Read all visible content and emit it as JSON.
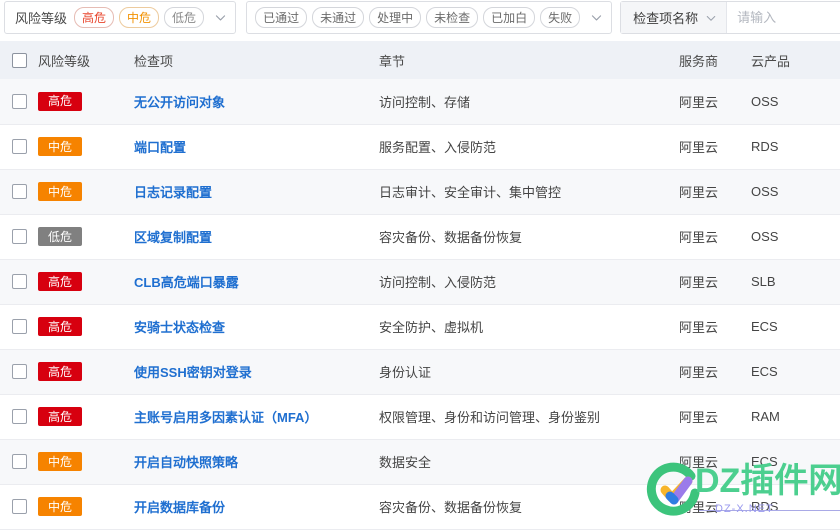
{
  "filters": {
    "risk": {
      "label": "风险等级",
      "chips": [
        {
          "text": "高危",
          "level": "high"
        },
        {
          "text": "中危",
          "level": "mid"
        },
        {
          "text": "低危",
          "level": "low"
        }
      ]
    },
    "status": {
      "chips": [
        {
          "text": "已通过"
        },
        {
          "text": "未通过"
        },
        {
          "text": "处理中"
        },
        {
          "text": "未检查"
        },
        {
          "text": "已加白"
        },
        {
          "text": "失败"
        }
      ]
    },
    "search": {
      "select_label": "检查项名称",
      "placeholder": "请输入",
      "value": ""
    }
  },
  "table": {
    "headers": {
      "risk": "风险等级",
      "item": "检查项",
      "section": "章节",
      "provider": "服务商",
      "product": "云产品"
    },
    "rows": [
      {
        "risk": "高危",
        "level": "high",
        "item": "无公开访问对象",
        "section": "访问控制、存储",
        "provider": "阿里云",
        "product": "OSS"
      },
      {
        "risk": "中危",
        "level": "mid",
        "item": "端口配置",
        "section": "服务配置、入侵防范",
        "provider": "阿里云",
        "product": "RDS"
      },
      {
        "risk": "中危",
        "level": "mid",
        "item": "日志记录配置",
        "section": "日志审计、安全审计、集中管控",
        "provider": "阿里云",
        "product": "OSS"
      },
      {
        "risk": "低危",
        "level": "low",
        "item": "区域复制配置",
        "section": "容灾备份、数据备份恢复",
        "provider": "阿里云",
        "product": "OSS"
      },
      {
        "risk": "高危",
        "level": "high",
        "item": "CLB高危端口暴露",
        "section": "访问控制、入侵防范",
        "provider": "阿里云",
        "product": "SLB"
      },
      {
        "risk": "高危",
        "level": "high",
        "item": "安骑士状态检查",
        "section": "安全防护、虚拟机",
        "provider": "阿里云",
        "product": "ECS"
      },
      {
        "risk": "高危",
        "level": "high",
        "item": "使用SSH密钥对登录",
        "section": "身份认证",
        "provider": "阿里云",
        "product": "ECS"
      },
      {
        "risk": "高危",
        "level": "high",
        "item": "主账号启用多因素认证（MFA）",
        "section": "权限管理、身份和访问管理、身份鉴别",
        "provider": "阿里云",
        "product": "RAM"
      },
      {
        "risk": "中危",
        "level": "mid",
        "item": "开启自动快照策略",
        "section": "数据安全",
        "provider": "阿里云",
        "product": "ECS"
      },
      {
        "risk": "中危",
        "level": "mid",
        "item": "开启数据库备份",
        "section": "容灾备份、数据备份恢复",
        "provider": "阿里云",
        "product": "RDS"
      }
    ]
  },
  "watermark": {
    "text": "DZ插件网",
    "sub": "DZ-X.NET"
  },
  "colors": {
    "high": "#d7000f",
    "mid": "#f68300",
    "low": "#808080",
    "link": "#1f6fd0",
    "header_bg": "#eef1f6",
    "watermark": "#4ccf8f"
  }
}
